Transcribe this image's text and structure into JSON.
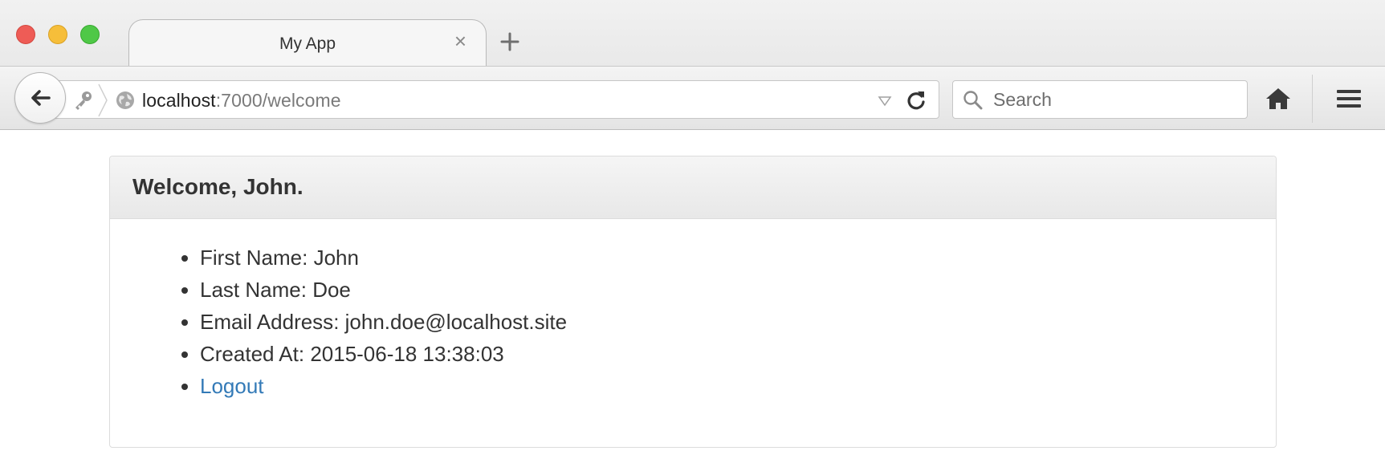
{
  "browser": {
    "tab_title": "My App",
    "url_host": "localhost",
    "url_path": ":7000/welcome",
    "search_placeholder": "Search"
  },
  "panel": {
    "title": "Welcome, John.",
    "items": [
      {
        "label": "First Name",
        "value": "John"
      },
      {
        "label": "Last Name",
        "value": "Doe"
      },
      {
        "label": "Email Address",
        "value": "john.doe@localhost.site"
      },
      {
        "label": "Created At",
        "value": "2015-06-18 13:38:03"
      }
    ],
    "logout_label": "Logout"
  },
  "colors": {
    "link": "#337ab7",
    "close_light": "#ee5c56",
    "minimize_light": "#f6be3a",
    "maximize_light": "#4fc847"
  }
}
